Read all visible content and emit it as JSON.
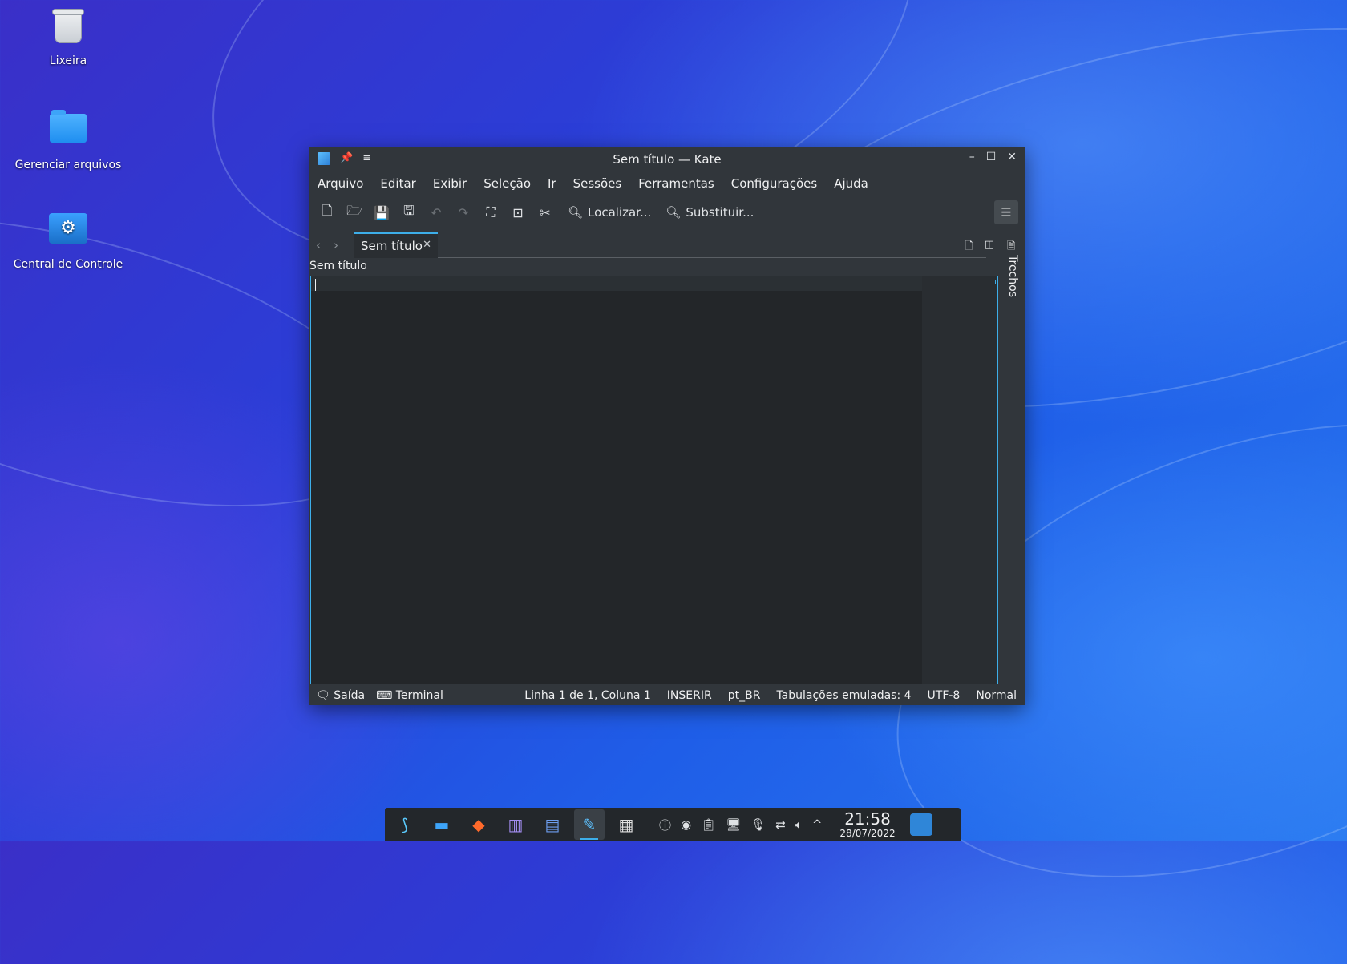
{
  "desktop": {
    "icons": [
      {
        "label": "Lixeira"
      },
      {
        "label": "Gerenciar arquivos"
      },
      {
        "label": "Central de Controle"
      }
    ]
  },
  "window": {
    "title": "Sem título — Kate",
    "menu": [
      "Arquivo",
      "Editar",
      "Exibir",
      "Seleção",
      "Ir",
      "Sessões",
      "Ferramentas",
      "Configurações",
      "Ajuda"
    ],
    "toolbar": {
      "find_label": "Localizar...",
      "replace_label": "Substituir..."
    },
    "tab": {
      "label": "Sem título"
    },
    "document_title": "Sem título",
    "sidebar_right_label": "Trechos",
    "status": {
      "output": "Saída",
      "terminal": "Terminal",
      "position": "Linha 1 de 1, Coluna 1",
      "mode": "INSERIR",
      "language": "pt_BR",
      "tabs": "Tabulações emuladas: 4",
      "encoding": "UTF-8",
      "highlight": "Normal"
    }
  },
  "taskbar": {
    "time": "21:58",
    "date": "28/07/2022"
  },
  "colors": {
    "accent": "#3daee9",
    "window_bg": "#31363b",
    "editor_bg": "#232629"
  }
}
